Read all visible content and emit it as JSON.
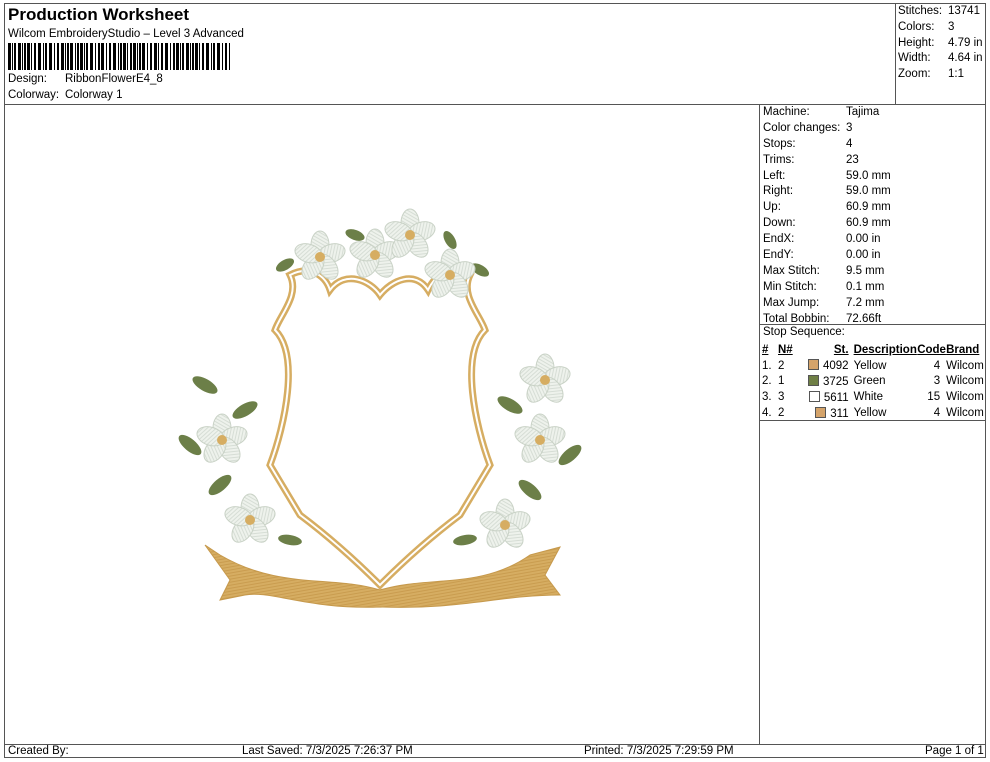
{
  "header": {
    "title": "Production Worksheet",
    "software": "Wilcom EmbroideryStudio – Level 3 Advanced",
    "design_label": "Design:",
    "design_value": "RibbonFlowerE4_8",
    "colorway_label": "Colorway:",
    "colorway_value": "Colorway 1"
  },
  "summary": [
    {
      "label": "Stitches:",
      "value": "13741"
    },
    {
      "label": "Colors:",
      "value": "3"
    },
    {
      "label": "Height:",
      "value": "4.79 in"
    },
    {
      "label": "Width:",
      "value": "4.64 in"
    },
    {
      "label": "Zoom:",
      "value": "1:1"
    }
  ],
  "specs": [
    {
      "label": "Machine:",
      "value": "Tajima"
    },
    {
      "label": "Color changes:",
      "value": "3"
    },
    {
      "label": "Stops:",
      "value": "4"
    },
    {
      "label": "Trims:",
      "value": "23"
    },
    {
      "label": "Left:",
      "value": "59.0 mm"
    },
    {
      "label": "Right:",
      "value": "59.0 mm"
    },
    {
      "label": "Up:",
      "value": "60.9 mm"
    },
    {
      "label": "Down:",
      "value": "60.9 mm"
    },
    {
      "label": "EndX:",
      "value": "0.00 in"
    },
    {
      "label": "EndY:",
      "value": "0.00 in"
    },
    {
      "label": "Max Stitch:",
      "value": "9.5 mm"
    },
    {
      "label": "Min Stitch:",
      "value": "0.1 mm"
    },
    {
      "label": "Max Jump:",
      "value": "7.2 mm"
    },
    {
      "label": "Total Bobbin:",
      "value": "72.66ft"
    }
  ],
  "stop_sequence": {
    "title": "Stop Sequence:",
    "headers": [
      "#",
      "N#",
      "St.",
      "Description",
      "Code",
      "Brand"
    ],
    "rows": [
      {
        "num": "1.",
        "n": "2",
        "color": "#d4a36a",
        "st": "4092",
        "desc": "Yellow",
        "code": "4",
        "brand": "Wilcom"
      },
      {
        "num": "2.",
        "n": "1",
        "color": "#6f7f45",
        "st": "3725",
        "desc": "Green",
        "code": "3",
        "brand": "Wilcom"
      },
      {
        "num": "3.",
        "n": "3",
        "color": "#ffffff",
        "st": "5611",
        "desc": "White",
        "code": "15",
        "brand": "Wilcom"
      },
      {
        "num": "4.",
        "n": "2",
        "color": "#d4a36a",
        "st": "311",
        "desc": "Yellow",
        "code": "4",
        "brand": "Wilcom"
      }
    ]
  },
  "footer": {
    "created_by": "Created By:",
    "last_saved": "Last Saved: 7/3/2025 7:26:37 PM",
    "printed": "Printed: 7/3/2025 7:29:59 PM",
    "page": "Page 1 of 1"
  },
  "colors": {
    "gold": "#d6ad62",
    "green": "#6c7f48",
    "white_thread": "#eef2ec"
  }
}
